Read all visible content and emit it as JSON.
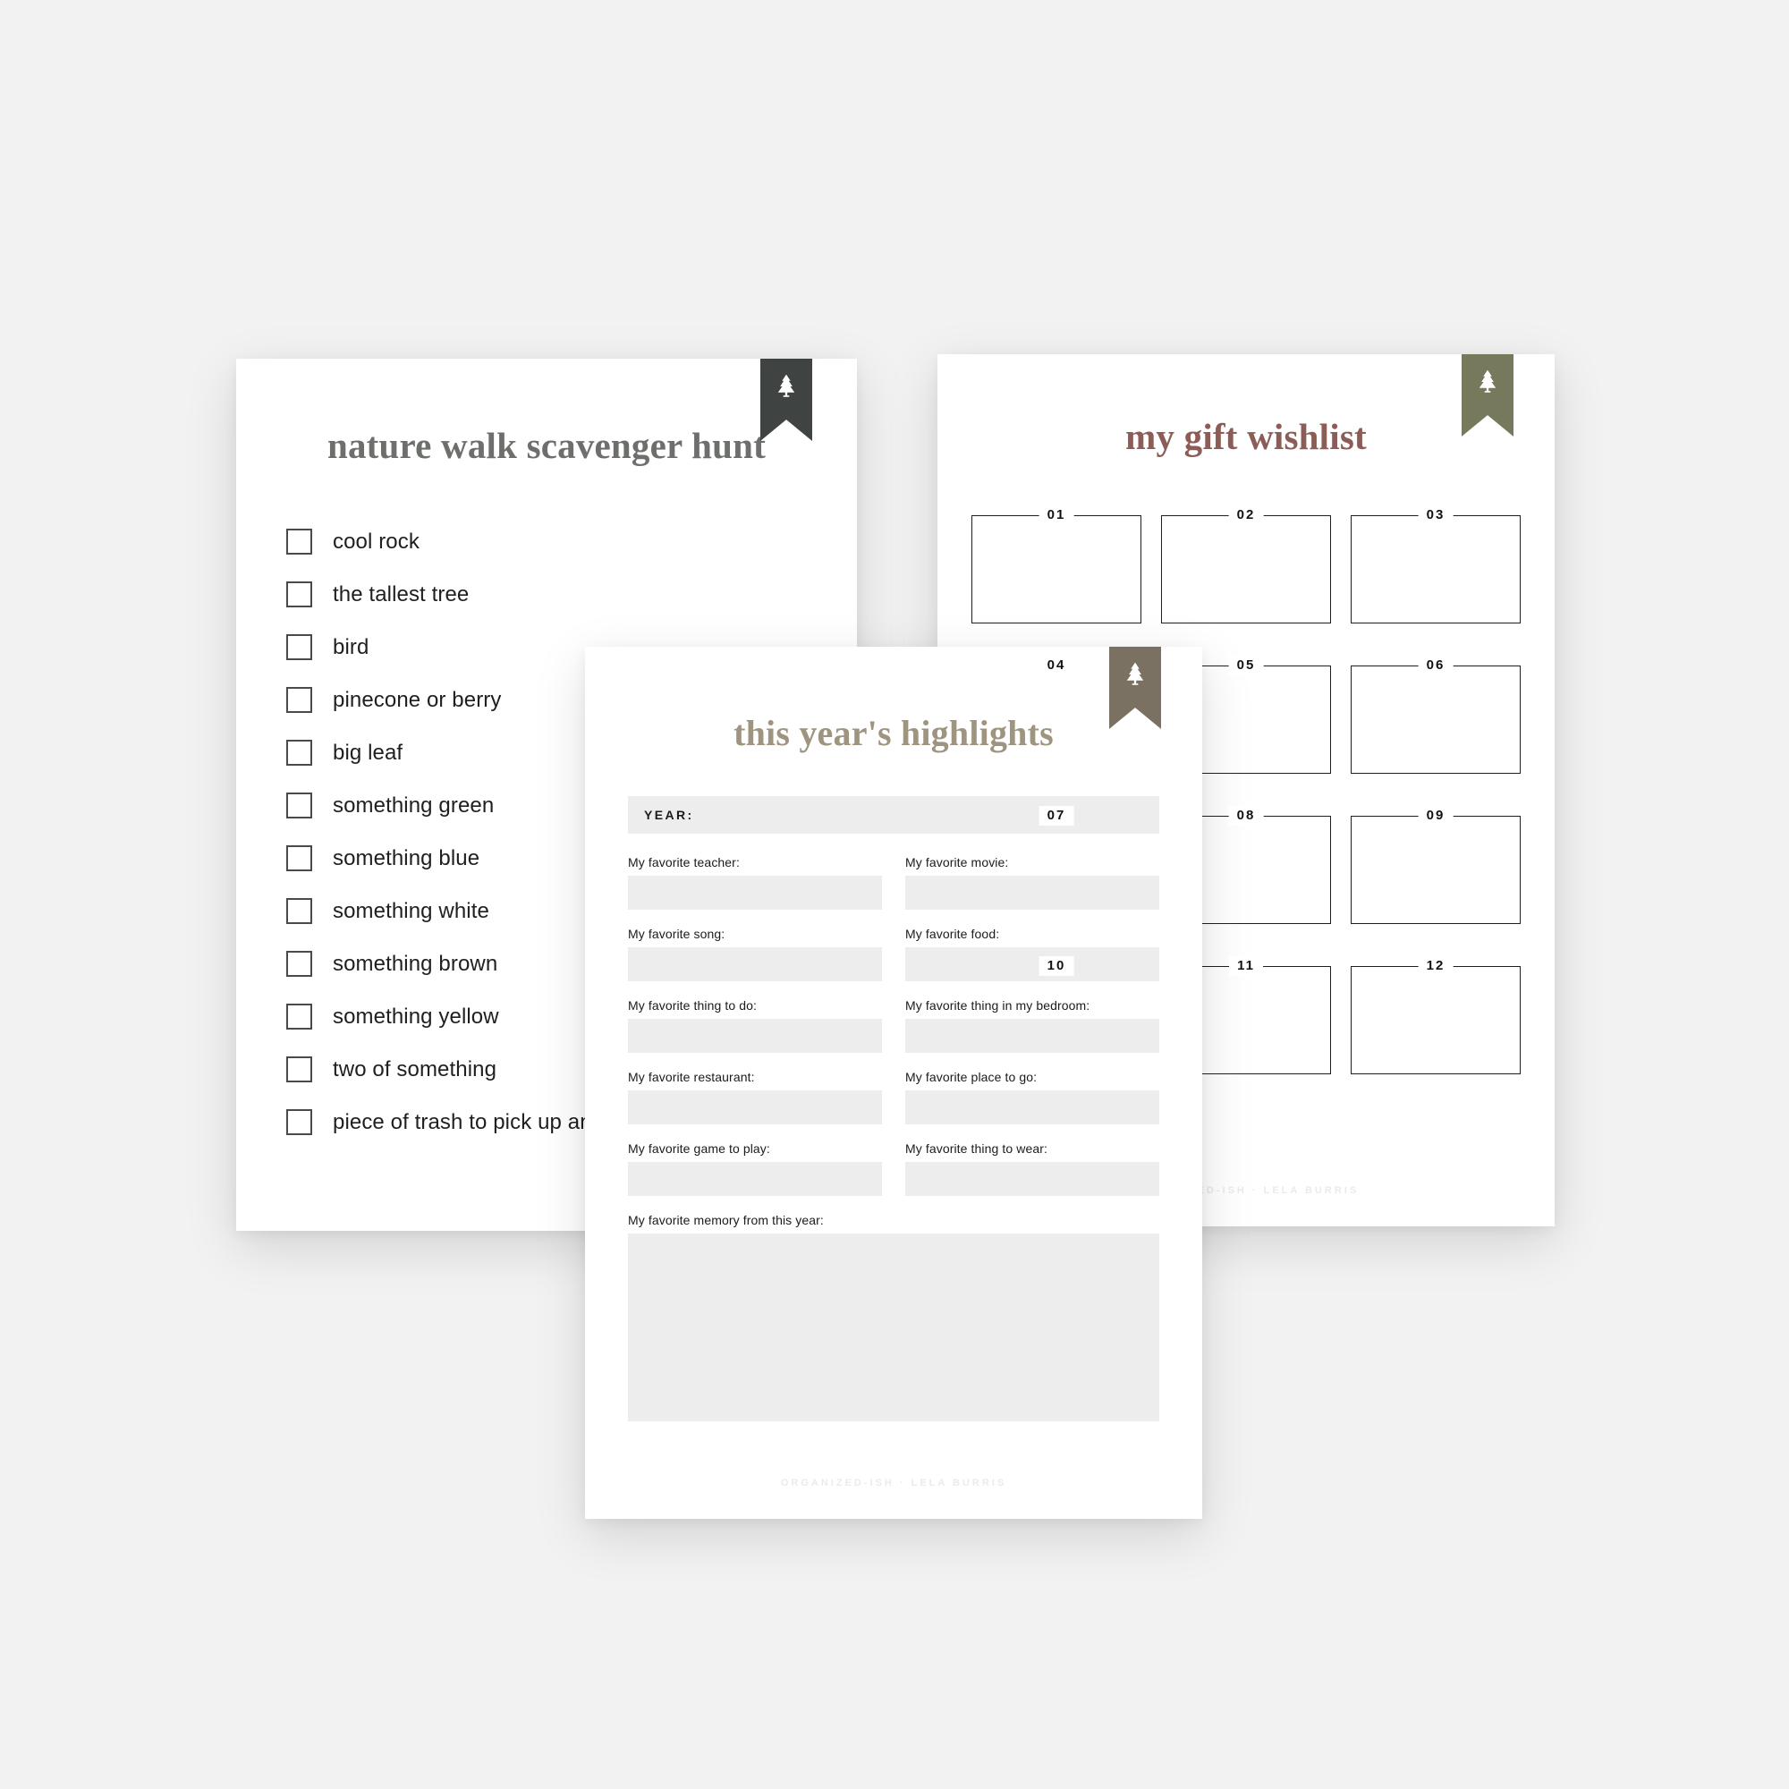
{
  "page": {
    "background_color": "#f2f2f2"
  },
  "cards": {
    "scavenger_hunt": {
      "title": "nature walk scavenger hunt",
      "title_color": "#6d6f6c",
      "ribbon_color": "#3f4341",
      "ribbon_icon": "pine-tree-icon",
      "items": [
        "cool rock",
        "the tallest tree",
        "bird",
        "pinecone or berry",
        "big leaf",
        "something green",
        "something blue",
        "something white",
        "something brown",
        "something yellow",
        "two of something",
        "piece of trash to pick up and throw away"
      ]
    },
    "gift_wishlist": {
      "title": "my gift wishlist",
      "title_color": "#8c5c56",
      "ribbon_color": "#76795b",
      "ribbon_icon": "pine-tree-icon",
      "numbers": [
        "01",
        "02",
        "03",
        "04",
        "05",
        "06",
        "07",
        "08",
        "09",
        "10",
        "11",
        "12"
      ],
      "footer": "ORGANIZED-ISH  ·  LELA BURRIS"
    },
    "highlights": {
      "title": "this year's highlights",
      "title_color": "#9e947f",
      "ribbon_color": "#7a7163",
      "ribbon_icon": "pine-tree-icon",
      "year_label": "YEAR:",
      "year_value": "",
      "fields": [
        {
          "label": "My favorite teacher:",
          "value": ""
        },
        {
          "label": "My favorite movie:",
          "value": ""
        },
        {
          "label": "My favorite song:",
          "value": ""
        },
        {
          "label": "My favorite food:",
          "value": ""
        },
        {
          "label": "My favorite thing to do:",
          "value": ""
        },
        {
          "label": "My favorite thing in my bedroom:",
          "value": ""
        },
        {
          "label": "My favorite restaurant:",
          "value": ""
        },
        {
          "label": "My favorite place to go:",
          "value": ""
        },
        {
          "label": "My favorite game to play:",
          "value": ""
        },
        {
          "label": "My favorite thing to wear:",
          "value": ""
        }
      ],
      "memory_field": {
        "label": "My favorite memory from this year:",
        "value": ""
      },
      "footer": "ORGANIZED-ISH  ·  LELA BURRIS"
    }
  }
}
